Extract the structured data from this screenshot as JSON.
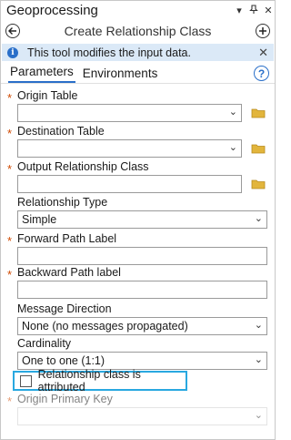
{
  "app_title": "Geoprocessing",
  "titlebar_icons": {
    "dropdown": "▾",
    "pin": "ᵩ",
    "close": "✕"
  },
  "tool_title": "Create Relationship Class",
  "info_message": "This tool modifies the input data.",
  "tabs": [
    "Parameters",
    "Environments"
  ],
  "active_tab": "Parameters",
  "required_marker": "*",
  "params": {
    "origin_table": {
      "label": "Origin Table",
      "value": ""
    },
    "destination_table": {
      "label": "Destination Table",
      "value": ""
    },
    "output_relationship_class": {
      "label": "Output Relationship Class",
      "value": ""
    },
    "relationship_type": {
      "label": "Relationship Type",
      "value": "Simple"
    },
    "forward_path_label": {
      "label": "Forward Path Label",
      "value": ""
    },
    "backward_path_label": {
      "label": "Backward Path label",
      "value": ""
    },
    "message_direction": {
      "label": "Message Direction",
      "value": "None (no messages propagated)"
    },
    "cardinality": {
      "label": "Cardinality",
      "value": "One to one (1:1)"
    },
    "attributed": {
      "label": "Relationship class is attributed",
      "checked": false
    },
    "origin_primary_key": {
      "label": "Origin Primary Key"
    }
  },
  "colors": {
    "accent": "#2a6fc9",
    "required": "#d04a02",
    "info_bg": "#dbe9f7",
    "highlight": "#29a8e0",
    "folder": "#e2b53c"
  }
}
